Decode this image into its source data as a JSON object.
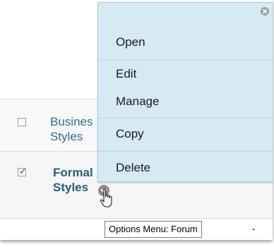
{
  "content": {
    "items": [
      {
        "title_line1": "Busines",
        "title_line2": "Styles",
        "checked": false
      },
      {
        "title_line1": "Formal",
        "title_line2": "Styles",
        "checked": true
      }
    ]
  },
  "context_menu": {
    "items": [
      {
        "label": "Open"
      },
      {
        "label": "Edit"
      },
      {
        "label": "Manage"
      },
      {
        "label": "Copy"
      },
      {
        "label": "Delete"
      }
    ],
    "close_icon": "close-icon"
  },
  "tooltip": {
    "text": "Options Menu: Forum"
  },
  "colors": {
    "menu_background": "#d5eaf3",
    "link_text": "#2e6f8a",
    "checkbox_check": "#2d4a9b"
  },
  "icons": {
    "options_button": "chevron-down-icon",
    "cursor": "hand-pointer-icon"
  }
}
